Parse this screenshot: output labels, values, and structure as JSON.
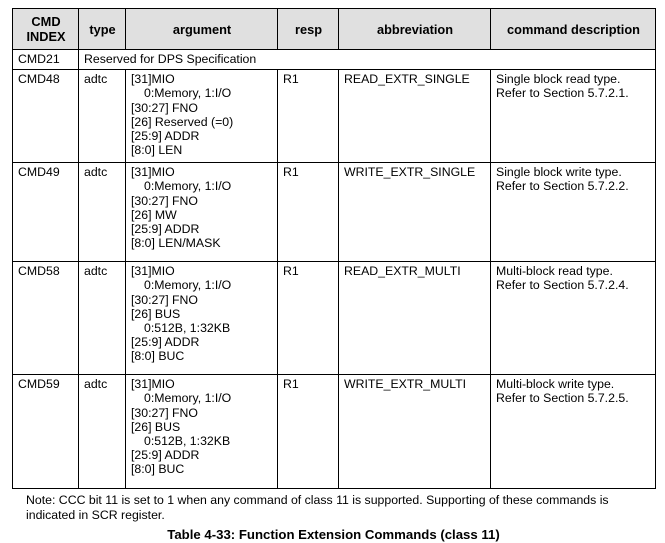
{
  "table": {
    "headers": [
      "CMD\nINDEX",
      "type",
      "argument",
      "resp",
      "abbreviation",
      "command description"
    ],
    "header_index_line1": "CMD",
    "header_index_line2": "INDEX",
    "header_type": "type",
    "header_argument": "argument",
    "header_resp": "resp",
    "header_abbreviation": "abbreviation",
    "header_description": "command description",
    "rows": [
      {
        "index": "CMD21",
        "spanned": true,
        "spanned_text": "Reserved for DPS Specification"
      },
      {
        "index": "CMD48",
        "type": "adtc",
        "argument_lines": [
          {
            "text": "[31]MIO",
            "indent": false
          },
          {
            "text": "0:Memory, 1:I/O",
            "indent": true
          },
          {
            "text": "[30:27] FNO",
            "indent": false
          },
          {
            "text": "[26] Reserved (=0)",
            "indent": false
          },
          {
            "text": "[25:9] ADDR",
            "indent": false
          },
          {
            "text": "[8:0] LEN",
            "indent": false
          }
        ],
        "resp": "R1",
        "abbreviation": "READ_EXTR_SINGLE",
        "description_lines": [
          "Single block read type.",
          "Refer to Section 5.7.2.1."
        ]
      },
      {
        "index": "CMD49",
        "type": "adtc",
        "argument_lines": [
          {
            "text": "[31]MIO",
            "indent": false
          },
          {
            "text": "0:Memory, 1:I/O",
            "indent": true
          },
          {
            "text": "[30:27] FNO",
            "indent": false
          },
          {
            "text": "[26] MW",
            "indent": false
          },
          {
            "text": "[25:9] ADDR",
            "indent": false
          },
          {
            "text": "[8:0] LEN/MASK",
            "indent": false
          }
        ],
        "resp": "R1",
        "abbreviation": "WRITE_EXTR_SINGLE",
        "description_lines": [
          "Single block write type.",
          "Refer to Section 5.7.2.2."
        ]
      },
      {
        "index": "CMD58",
        "type": "adtc",
        "argument_lines": [
          {
            "text": "[31]MIO",
            "indent": false
          },
          {
            "text": "0:Memory, 1:I/O",
            "indent": true
          },
          {
            "text": "[30:27] FNO",
            "indent": false
          },
          {
            "text": "[26] BUS",
            "indent": false
          },
          {
            "text": "0:512B, 1:32KB",
            "indent": true
          },
          {
            "text": "[25:9] ADDR",
            "indent": false
          },
          {
            "text": "[8:0] BUC",
            "indent": false
          }
        ],
        "resp": "R1",
        "abbreviation": "READ_EXTR_MULTI",
        "description_lines": [
          "Multi-block read type.",
          "Refer to Section 5.7.2.4."
        ]
      },
      {
        "index": "CMD59",
        "type": "adtc",
        "argument_lines": [
          {
            "text": "[31]MIO",
            "indent": false
          },
          {
            "text": "0:Memory, 1:I/O",
            "indent": true
          },
          {
            "text": "[30:27] FNO",
            "indent": false
          },
          {
            "text": "[26] BUS",
            "indent": false
          },
          {
            "text": "0:512B, 1:32KB",
            "indent": true
          },
          {
            "text": "[25:9] ADDR",
            "indent": false
          },
          {
            "text": "[8:0] BUC",
            "indent": false
          }
        ],
        "resp": "R1",
        "abbreviation": "WRITE_EXTR_MULTI",
        "description_lines": [
          "Multi-block write type.",
          "Refer to Section 5.7.2.5."
        ]
      }
    ]
  },
  "note": "Note: CCC bit 11 is set to 1 when any command of class 11 is supported. Supporting of these commands is indicated in SCR register.",
  "caption": "Table 4-33: Function Extension Commands (class 11)",
  "colors": {
    "header_background": "#e0e0e0",
    "border": "#000000",
    "text": "#000000",
    "page_background": "#ffffff"
  }
}
